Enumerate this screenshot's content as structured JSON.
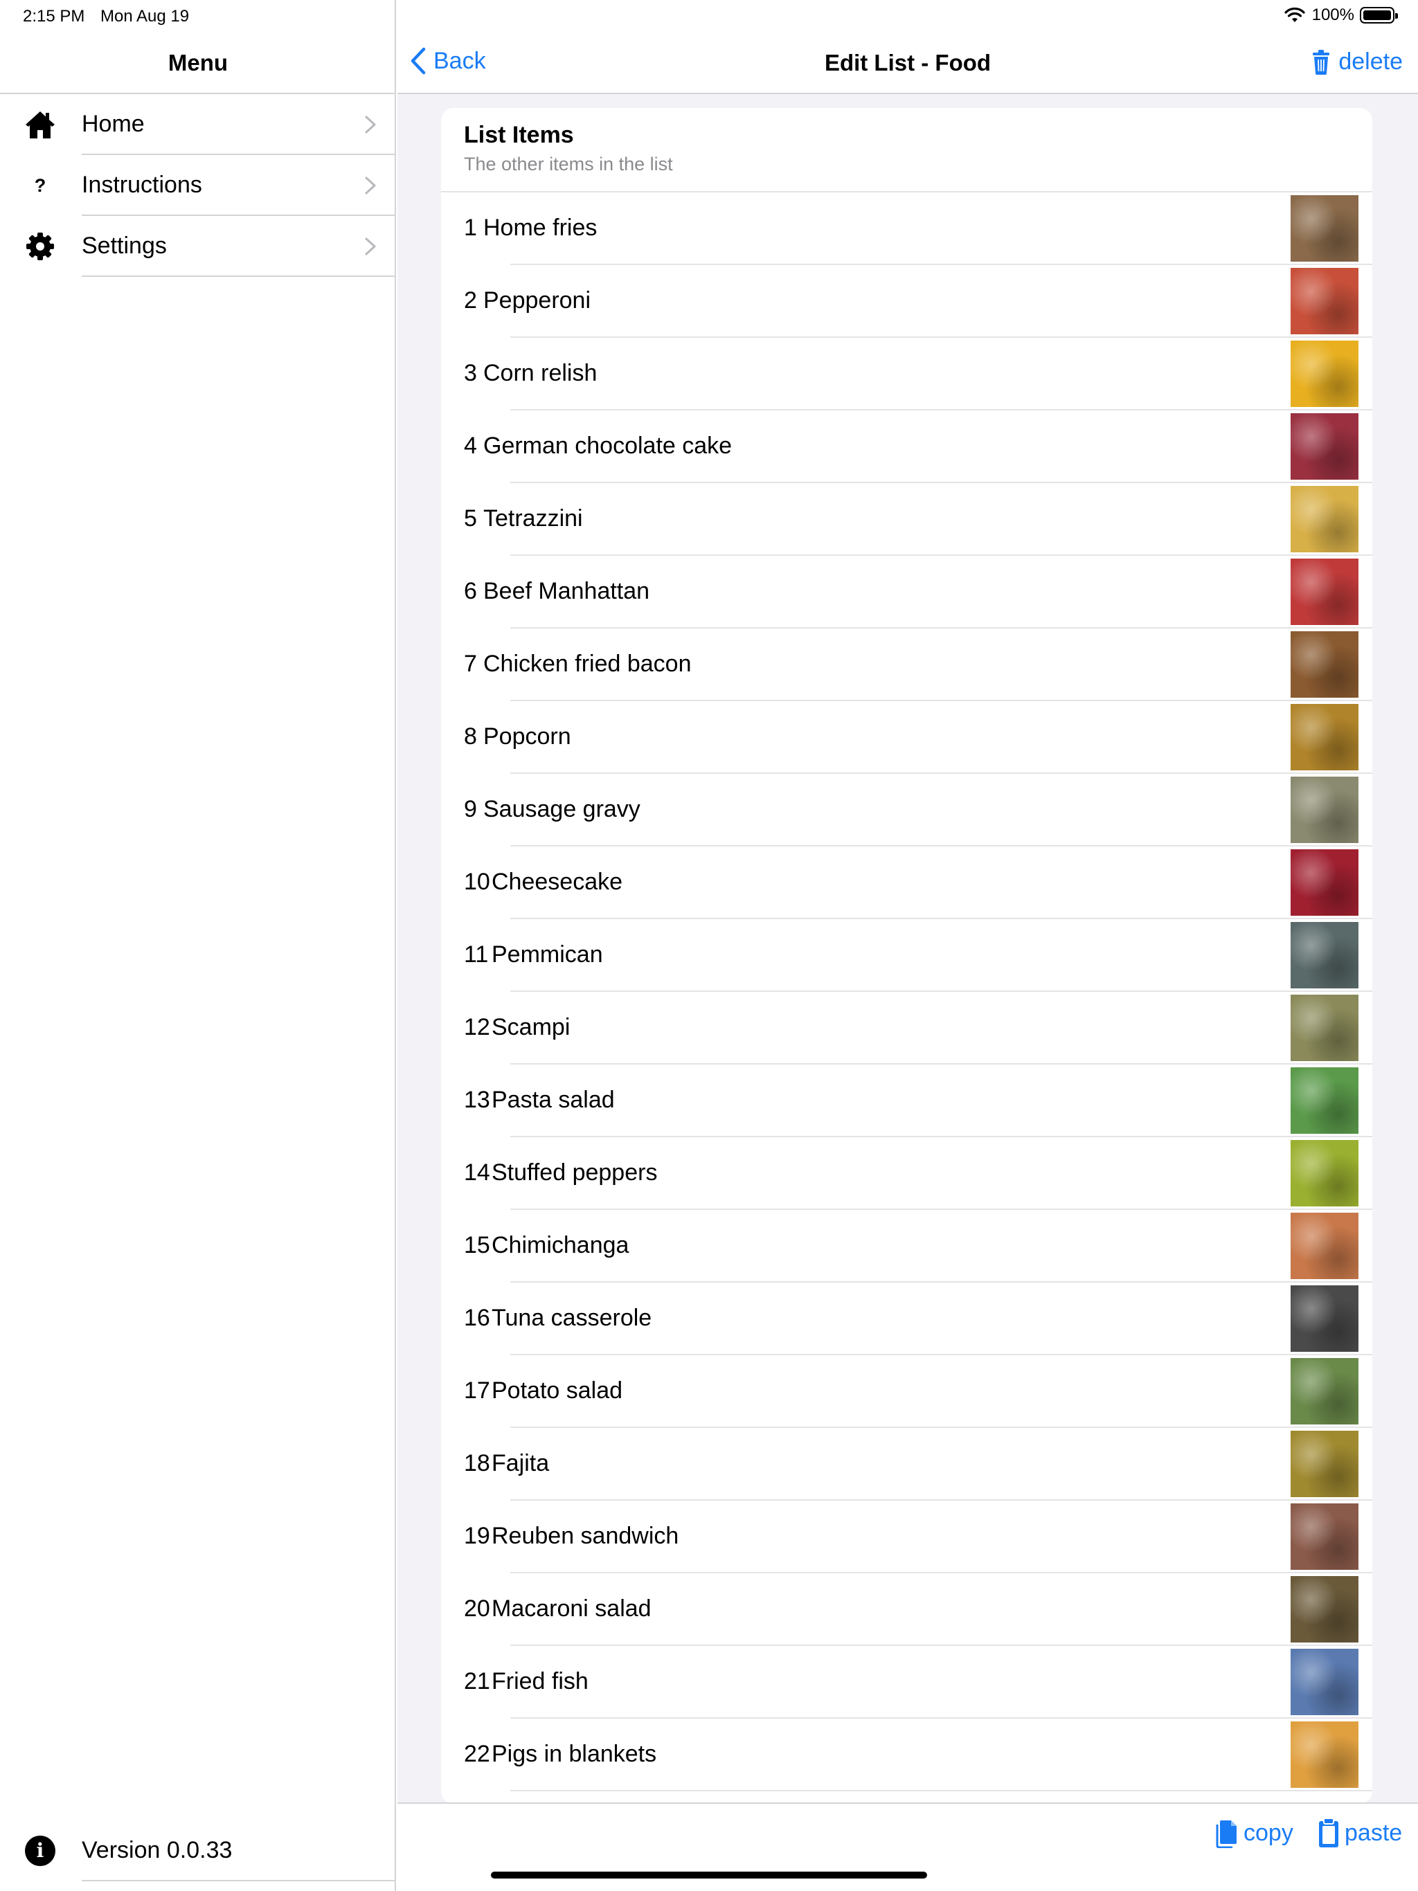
{
  "status_bar": {
    "time": "2:15 PM",
    "date": "Mon Aug 19",
    "battery": "100%"
  },
  "sidebar": {
    "title": "Menu",
    "items": [
      {
        "label": "Home",
        "icon": "house-icon"
      },
      {
        "label": "Instructions",
        "icon": "question-icon"
      },
      {
        "label": "Settings",
        "icon": "gear-icon"
      }
    ],
    "question_glyph": "?",
    "version": "Version 0.0.33",
    "info_glyph": "i"
  },
  "navbar": {
    "back_label": "Back",
    "title": "Edit List - Food",
    "delete_label": "delete"
  },
  "card": {
    "title": "List Items",
    "subtitle": "The other items in the list",
    "items": [
      {
        "num": "1",
        "name": "Home fries",
        "color": "#8a6a4a"
      },
      {
        "num": "2",
        "name": "Pepperoni",
        "color": "#c8503a"
      },
      {
        "num": "3",
        "name": "Corn relish",
        "color": "#e8b020"
      },
      {
        "num": "4",
        "name": "German chocolate cake",
        "color": "#9a3040"
      },
      {
        "num": "5",
        "name": "Tetrazzini",
        "color": "#d8b048"
      },
      {
        "num": "6",
        "name": "Beef Manhattan",
        "color": "#c03a3a"
      },
      {
        "num": "7",
        "name": "Chicken fried bacon",
        "color": "#8a5a30"
      },
      {
        "num": "8",
        "name": "Popcorn",
        "color": "#b0842a"
      },
      {
        "num": "9",
        "name": "Sausage gravy",
        "color": "#8a8a70"
      },
      {
        "num": "10",
        "name": "Cheesecake",
        "color": "#a02030"
      },
      {
        "num": "11",
        "name": "Pemmican",
        "color": "#5a6a6a"
      },
      {
        "num": "12",
        "name": "Scampi",
        "color": "#8a8a5a"
      },
      {
        "num": "13",
        "name": "Pasta salad",
        "color": "#5a9a4a"
      },
      {
        "num": "14",
        "name": "Stuffed peppers",
        "color": "#9ab030"
      },
      {
        "num": "15",
        "name": "Chimichanga",
        "color": "#c8784a"
      },
      {
        "num": "16",
        "name": "Tuna casserole",
        "color": "#4a4a4a"
      },
      {
        "num": "17",
        "name": "Potato salad",
        "color": "#6a8a4a"
      },
      {
        "num": "18",
        "name": "Fajita",
        "color": "#a08a30"
      },
      {
        "num": "19",
        "name": "Reuben sandwich",
        "color": "#8a5a4a"
      },
      {
        "num": "20",
        "name": "Macaroni salad",
        "color": "#6a5a3a"
      },
      {
        "num": "21",
        "name": "Fried fish",
        "color": "#5a7ab0"
      },
      {
        "num": "22",
        "name": "Pigs in blankets",
        "color": "#e0a040"
      }
    ]
  },
  "bottom_bar": {
    "copy_label": "copy",
    "paste_label": "paste"
  },
  "colors": {
    "accent": "#1a7cf5",
    "separator": "#d4d4d6",
    "background": "#f2f2f7",
    "subtitle": "#8a8a8e"
  }
}
